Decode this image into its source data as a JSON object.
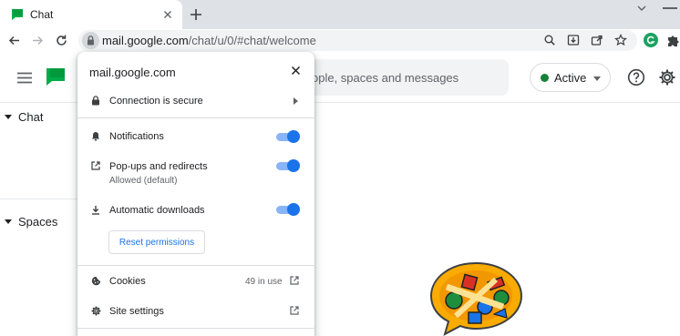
{
  "browser": {
    "tab": {
      "title": "Chat",
      "close_icon": "close-icon"
    },
    "new_tab_icon": "plus-icon",
    "address_bar": {
      "domain": "mail.google.com",
      "path": "/chat/u/0/#chat/welcome"
    }
  },
  "chat_app": {
    "search_placeholder": "ople, spaces and messages",
    "status": {
      "label": "Active",
      "color": "#188038"
    },
    "sections": {
      "chat": "Chat",
      "spaces": "Spaces"
    }
  },
  "site_info": {
    "domain": "mail.google.com",
    "connection": "Connection is secure",
    "permissions": [
      {
        "label": "Notifications",
        "enabled": true
      },
      {
        "label": "Pop-ups and redirects",
        "sublabel": "Allowed (default)",
        "enabled": true
      },
      {
        "label": "Automatic downloads",
        "enabled": true
      }
    ],
    "reset_button": "Reset permissions",
    "cookies": {
      "label": "Cookies",
      "count": "49 in use"
    },
    "site_settings": "Site settings"
  },
  "colors": {
    "accent": "#1a73e8",
    "toggle_track": "#8ab4f8",
    "chat_green": "#00ac47"
  }
}
